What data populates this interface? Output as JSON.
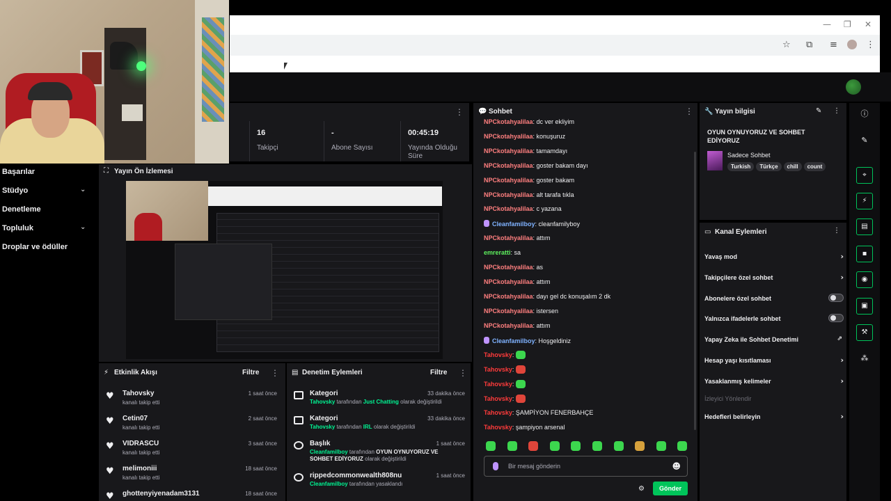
{
  "browser": {
    "win_min": "—",
    "win_max": "❐",
    "win_close": "✕",
    "icons": [
      "star-icon",
      "extensions-icon",
      "media-icon",
      "profile-icon",
      "menu-icon"
    ]
  },
  "nav": {
    "items": [
      {
        "label": "Başarılar",
        "chevron": false
      },
      {
        "label": "Stüdyo",
        "chevron": true
      },
      {
        "label": "Denetleme",
        "chevron": false
      },
      {
        "label": "Topluluk",
        "chevron": true
      },
      {
        "label": "Droplar ve ödüller",
        "chevron": false
      }
    ]
  },
  "stats": {
    "followers_value": "16",
    "followers_label": "Takipçi",
    "subs_value": "-",
    "subs_label": "Abone Sayısı",
    "live_value": "00:45:19",
    "live_label": "Yayında Olduğu Süre"
  },
  "preview": {
    "title": "Yayın Ön İzlemesi"
  },
  "activity": {
    "title": "Etkinlik Akışı",
    "filter": "Filtre",
    "items": [
      {
        "name": "Tahovsky",
        "sub": "kanalı takip etti",
        "time": "1 saat önce"
      },
      {
        "name": "Cetin07",
        "sub": "kanalı takip etti",
        "time": "2 saat önce"
      },
      {
        "name": "VIDRASCU",
        "sub": "kanalı takip etti",
        "time": "3 saat önce"
      },
      {
        "name": "melimoniii",
        "sub": "kanalı takip etti",
        "time": "18 saat önce"
      },
      {
        "name": "ghottenyiyenadam3131",
        "sub": "",
        "time": "18 saat önce"
      }
    ]
  },
  "mod": {
    "title": "Denetim Eylemleri",
    "filter": "Filtre",
    "items": [
      {
        "title": "Kategori",
        "time": "33 dakika önce",
        "actor": "Tahovsky",
        "mid": " tarafından ",
        "target": "Just Chatting",
        "end": " olarak değiştirildi"
      },
      {
        "title": "Kategori",
        "time": "33 dakika önce",
        "actor": "Tahovsky",
        "mid": " tarafından ",
        "target": "IRL",
        "end": " olarak değiştirildi"
      },
      {
        "title": "Başlık",
        "time": "1 saat önce",
        "actor": "Cleanfamilboy",
        "mid": " tarafından ",
        "target": "OYUN OYNUYORUZ VE SOHBET EDİYORUZ",
        "end": " olarak değiştirildi"
      },
      {
        "title": "rippedcommonwealth808nu",
        "time": "1 saat önce",
        "actor": "Cleanfamilboy",
        "mid": " tarafından yasaklandı",
        "target": "",
        "end": ""
      }
    ]
  },
  "chat": {
    "title": "Sohbet",
    "messages": [
      {
        "user": "NPCkotahyalilaa",
        "color": "#ff7f7f",
        "text": "dc ver ekliyim",
        "badge": false
      },
      {
        "user": "NPCkotahyalilaa",
        "color": "#ff7f7f",
        "text": "konuşuruz",
        "badge": false
      },
      {
        "user": "NPCkotahyalilaa",
        "color": "#ff7f7f",
        "text": "tamamdayı",
        "badge": false
      },
      {
        "user": "NPCkotahyalilaa",
        "color": "#ff7f7f",
        "text": "goster bakam dayı",
        "badge": false
      },
      {
        "user": "NPCkotahyalilaa",
        "color": "#ff7f7f",
        "text": "goster bakam",
        "badge": false
      },
      {
        "user": "NPCkotahyalilaa",
        "color": "#ff7f7f",
        "text": "alt tarafa tıkla",
        "badge": false
      },
      {
        "user": "NPCkotahyalilaa",
        "color": "#ff7f7f",
        "text": "c yazana",
        "badge": false
      },
      {
        "user": "Cleanfamilboy",
        "color": "#7fb2ff",
        "text": "cleanfamilyboy",
        "badge": true
      },
      {
        "user": "NPCkotahyalilaa",
        "color": "#ff7f7f",
        "text": "attım",
        "badge": false
      },
      {
        "user": "emreratti",
        "color": "#5ef05e",
        "text": "sa",
        "badge": false
      },
      {
        "user": "NPCkotahyalilaa",
        "color": "#ff7f7f",
        "text": "as",
        "badge": false
      },
      {
        "user": "NPCkotahyalilaa",
        "color": "#ff7f7f",
        "text": "attım",
        "badge": false
      },
      {
        "user": "NPCkotahyalilaa",
        "color": "#ff7f7f",
        "text": "dayı gel dc konuşalım 2 dk",
        "badge": false
      },
      {
        "user": "NPCkotahyalilaa",
        "color": "#ff7f7f",
        "text": "istersen",
        "badge": false
      },
      {
        "user": "NPCkotahyalilaa",
        "color": "#ff7f7f",
        "text": "attım",
        "badge": false
      },
      {
        "user": "Cleanfamilboy",
        "color": "#7fb2ff",
        "text": "Hoşgeldiniz",
        "badge": true
      },
      {
        "user": "Tahovsky",
        "color": "#ff3b3b",
        "text": "",
        "badge": false,
        "emote": "#3cd64e"
      },
      {
        "user": "Tahovsky",
        "color": "#ff3b3b",
        "text": "",
        "badge": false,
        "emote": "#e0453a"
      },
      {
        "user": "Tahovsky",
        "color": "#ff3b3b",
        "text": "",
        "badge": false,
        "emote": "#3cd64e"
      },
      {
        "user": "Tahovsky",
        "color": "#ff3b3b",
        "text": "",
        "badge": false,
        "emote": "#e0453a"
      },
      {
        "user": "Tahovsky",
        "color": "#ff3b3b",
        "text": "ŞAMPİYON FENERBAHÇE",
        "badge": false
      },
      {
        "user": "Tahovsky",
        "color": "#ff3b3b",
        "text": "şampiyon arsenal",
        "badge": false
      }
    ],
    "emote_colors": [
      "#3cd64e",
      "#3cd64e",
      "#e0453a",
      "#3cd64e",
      "#3cd64e",
      "#3cd64e",
      "#3cd64e",
      "#d6a13c",
      "#3cd64e",
      "#3cd64e"
    ],
    "input_placeholder": "Bir mesaj gönderin",
    "send_label": "Gönder"
  },
  "info": {
    "title": "Yayın bilgisi",
    "stream_title": "OYUN OYNUYORUZ VE SOHBET EDİYORUZ",
    "category": "Sadece Sohbet",
    "tags": [
      "Turkish",
      "Türkçe",
      "chill",
      "count"
    ]
  },
  "channel_actions": {
    "title": "Kanal Eylemleri",
    "items": [
      {
        "label": "Yavaş mod",
        "control": "chevron"
      },
      {
        "label": "Takipçilere özel sohbet",
        "control": "chevron"
      },
      {
        "label": "Abonelere özel sohbet",
        "control": "toggle"
      },
      {
        "label": "Yalnızca ifadelerle sohbet",
        "control": "toggle"
      },
      {
        "label": "Yapay Zeka ile Sohbet Denetimi",
        "control": "external"
      },
      {
        "label": "Hesap yaşı kısıtlaması",
        "control": "chevron"
      },
      {
        "label": "Yasaklanmış kelimeler",
        "control": "chevron"
      },
      {
        "label": "İzleyici Yönlendir",
        "control": "disabled"
      },
      {
        "label": "Hedefleri belirleyin",
        "control": "chevron"
      }
    ]
  },
  "accent_color": "#00c45a"
}
